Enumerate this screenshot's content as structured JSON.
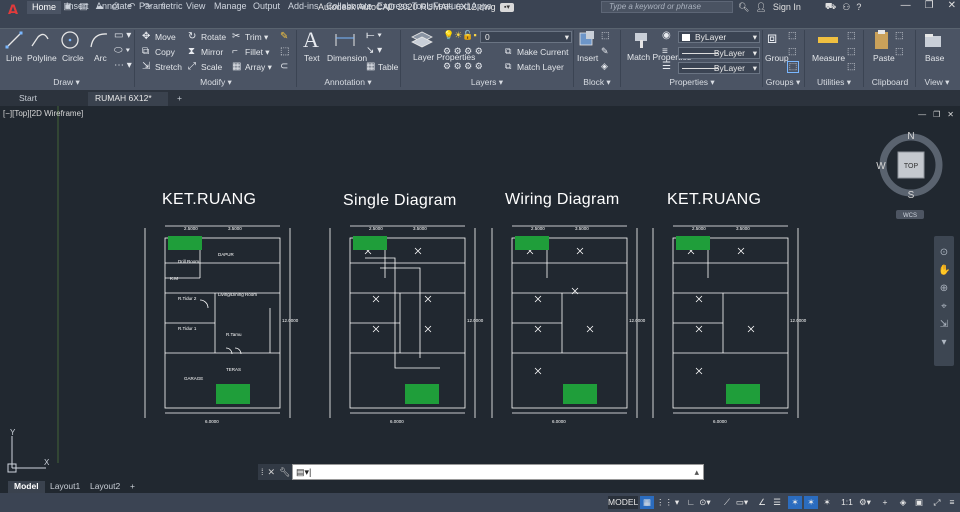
{
  "app": {
    "logo": "A",
    "title": "Autodesk AutoCAD 2020    RUMAH 6X12.dwg",
    "search_placeholder": "Type a keyword or phrase",
    "sign_in": "Sign In"
  },
  "ribbon_tabs": [
    "Home",
    "Insert",
    "Annotate",
    "Parametric",
    "View",
    "Manage",
    "Output",
    "Add-ins",
    "Collaborate",
    "Express Tools",
    "Featured Apps"
  ],
  "ribbon": {
    "draw": {
      "label": "Draw ▾",
      "line": "Line",
      "polyline": "Polyline",
      "circle": "Circle",
      "arc": "Arc"
    },
    "modify": {
      "label": "Modify ▾",
      "move": "Move",
      "rotate": "Rotate",
      "trim": "Trim ▾",
      "copy": "Copy",
      "mirror": "Mirror",
      "fillet": "Fillet ▾",
      "stretch": "Stretch",
      "scale": "Scale",
      "array": "Array ▾"
    },
    "annotation": {
      "label": "Annotation ▾",
      "text": "Text",
      "dimension": "Dimension",
      "table": "Table"
    },
    "layers": {
      "label": "Layers ▾",
      "layer_properties": "Layer Properties",
      "layer_value": "0",
      "make_current": "Make Current",
      "match_layer": "Match Layer"
    },
    "block": {
      "label": "Block ▾",
      "insert": "Insert"
    },
    "properties": {
      "label": "Properties ▾",
      "match_properties": "Match Properties",
      "color": "ByLayer",
      "linetype": "ByLayer",
      "lineweight": "ByLayer"
    },
    "groups": {
      "label": "Groups ▾",
      "group": "Group"
    },
    "utilities": {
      "label": "Utilities ▾",
      "measure": "Measure"
    },
    "clipboard": {
      "label": "Clipboard",
      "paste": "Paste"
    },
    "view": {
      "label": "View ▾",
      "base": "Base"
    }
  },
  "doc_tabs": [
    "Start",
    "RUMAH 6X12*"
  ],
  "viewport": {
    "label": "[−][Top][2D Wireframe]",
    "viewcube": {
      "top": "TOP",
      "n": "N",
      "s": "S",
      "w": "W",
      "wcs": "WCS"
    },
    "titles": [
      "KET.RUANG",
      "Single Diagram",
      "Wiring Diagram",
      "KET.RUANG"
    ],
    "room_labels": {
      "dapur": "DAPUR",
      "drill_room": "Drill Room",
      "km": "K.M",
      "rtidur2": "R.Tidur 2",
      "living": "Living/Dining Room",
      "rtidur1": "R.Tidur 1",
      "rtamu": "R.Tamu",
      "teras": "TERAS",
      "garage": "GARAGE"
    },
    "dims": {
      "d1": "2.5000",
      "d2": "3.5000",
      "d3": "6.0000",
      "d4": "12.0000",
      "d5": "3.0000",
      "d6": "4.5000",
      "d7": "1.5000"
    }
  },
  "ucs": {
    "x": "X",
    "y": "Y"
  },
  "command": {
    "prompt": ""
  },
  "layout_tabs": [
    "Model",
    "Layout1",
    "Layout2"
  ],
  "status": {
    "model": "MODEL",
    "scale": "1:1"
  }
}
